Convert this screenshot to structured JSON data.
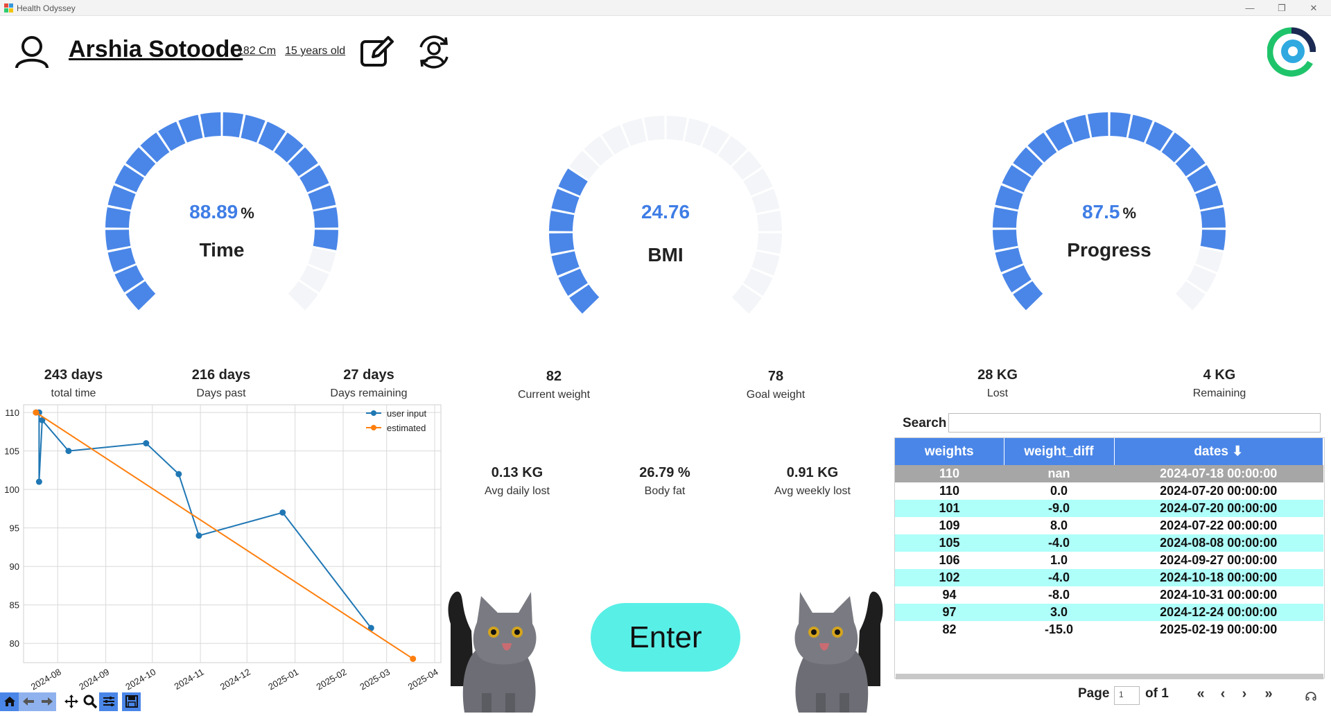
{
  "window": {
    "title": "Health Odyssey"
  },
  "user": {
    "name": "Arshia Sotoode",
    "height": "182 Cm",
    "age": "15 years old"
  },
  "gauges": {
    "time": {
      "value": "88.89",
      "unit": "%",
      "label": "Time"
    },
    "bmi": {
      "value": "24.76",
      "label": "BMI"
    },
    "progress": {
      "value": "87.5",
      "unit": "%",
      "label": "Progress"
    }
  },
  "stats": {
    "total_time": {
      "value": "243 days",
      "label": "total time"
    },
    "days_past": {
      "value": "216 days",
      "label": "Days past"
    },
    "days_remaining": {
      "value": "27 days",
      "label": "Days remaining"
    },
    "current_weight": {
      "value": "82",
      "label": "Current weight"
    },
    "goal_weight": {
      "value": "78",
      "label": "Goal weight"
    },
    "lost": {
      "value": "28 KG",
      "label": "Lost"
    },
    "remaining": {
      "value": "4 KG",
      "label": "Remaining"
    },
    "avg_daily": {
      "value": "0.13 KG",
      "label": "Avg daily lost"
    },
    "body_fat": {
      "value": "26.79 %",
      "label": "Body fat"
    },
    "avg_weekly": {
      "value": "0.91 KG",
      "label": "Avg weekly lost"
    }
  },
  "chart_data": {
    "type": "line",
    "x_ticks": [
      "2024-08",
      "2024-09",
      "2024-10",
      "2024-11",
      "2024-12",
      "2025-01",
      "2025-02",
      "2025-03",
      "2025-04"
    ],
    "y_ticks": [
      110,
      105,
      100,
      95,
      90,
      85,
      80
    ],
    "ylim": [
      77.5,
      111
    ],
    "legend": [
      "user input",
      "estimated"
    ],
    "legend_position": "top-right",
    "grid": true,
    "series": [
      {
        "name": "user input",
        "color": "#1f77b4",
        "points": [
          [
            "2024-07-18",
            110
          ],
          [
            "2024-07-20",
            110
          ],
          [
            "2024-07-20",
            101
          ],
          [
            "2024-07-22",
            109
          ],
          [
            "2024-08-08",
            105
          ],
          [
            "2024-09-27",
            106
          ],
          [
            "2024-10-18",
            102
          ],
          [
            "2024-10-31",
            94
          ],
          [
            "2024-12-24",
            97
          ],
          [
            "2025-02-19",
            82
          ]
        ]
      },
      {
        "name": "estimated",
        "color": "#ff7f0e",
        "points": [
          [
            "2024-07-18",
            110
          ],
          [
            "2025-03-18",
            78
          ]
        ]
      }
    ]
  },
  "table": {
    "search_label": "Search",
    "columns": [
      "weights",
      "weight_diff",
      "dates ⬇"
    ],
    "rows": [
      [
        "110",
        "nan",
        "2024-07-18 00:00:00"
      ],
      [
        "110",
        "0.0",
        "2024-07-20 00:00:00"
      ],
      [
        "101",
        "-9.0",
        "2024-07-20 00:00:00"
      ],
      [
        "109",
        "8.0",
        "2024-07-22 00:00:00"
      ],
      [
        "105",
        "-4.0",
        "2024-08-08 00:00:00"
      ],
      [
        "106",
        "1.0",
        "2024-09-27 00:00:00"
      ],
      [
        "102",
        "-4.0",
        "2024-10-18 00:00:00"
      ],
      [
        "94",
        "-8.0",
        "2024-10-31 00:00:00"
      ],
      [
        "97",
        "3.0",
        "2024-12-24 00:00:00"
      ],
      [
        "82",
        "-15.0",
        "2025-02-19 00:00:00"
      ]
    ],
    "pager": {
      "page_label": "Page",
      "page_value": "1",
      "of_label": "of 1",
      "first": "«",
      "prev": "‹",
      "next": "›",
      "last": "»"
    }
  },
  "enter_button": {
    "label": "Enter"
  },
  "colors": {
    "gauge_on": "#4a86e8",
    "gauge_off": "#f3f5f8",
    "enter": "#58efe6",
    "row_alt": "#aefff9",
    "header": "#4a86e8"
  }
}
